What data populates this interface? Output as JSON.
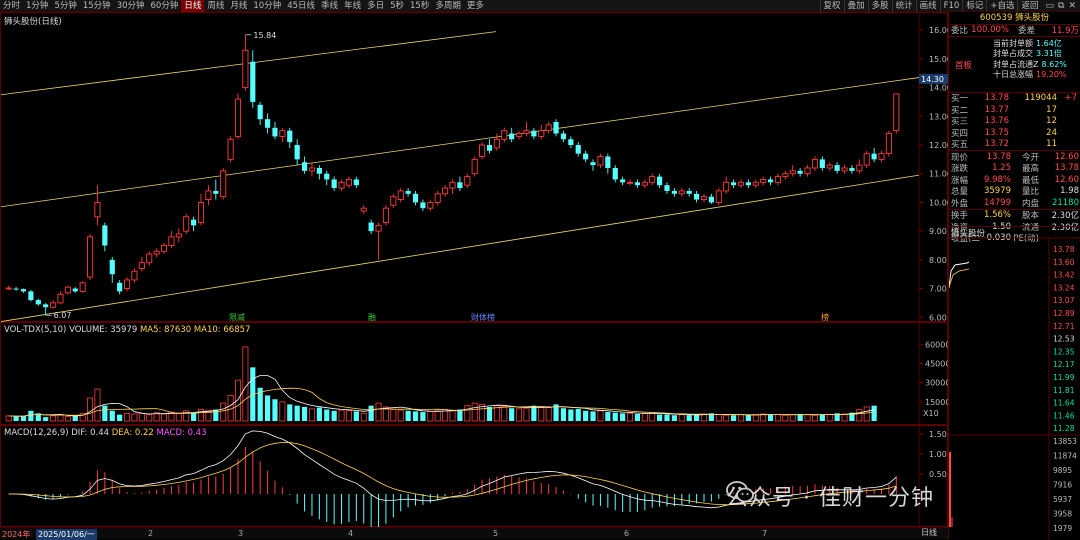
{
  "toolbar": {
    "periods": [
      "分时",
      "1分钟",
      "5分钟",
      "15分钟",
      "30分钟",
      "60分钟",
      "日线",
      "周线",
      "月线",
      "10分钟",
      "45日线",
      "季线",
      "年线",
      "多日",
      "5秒",
      "15秒",
      "多周期",
      "更多"
    ],
    "active_period": "日线",
    "tools": [
      "复权",
      "叠加",
      "多股",
      "统计",
      "画线",
      "F10",
      "标记",
      "+自选",
      "返回"
    ]
  },
  "main_chart": {
    "title": "狮头股份(日线)",
    "price_axis": [
      "16.00",
      "15.00",
      "14.00",
      "13.00",
      "12.00",
      "11.00",
      "10.00",
      "9.00",
      "8.00",
      "7.00",
      "6.00"
    ],
    "current_price_tag": "14.30",
    "high_label": "15.84",
    "low_label": "6.07",
    "markers": [
      {
        "text": "限减",
        "color": "#33cc33"
      },
      {
        "text": "融",
        "color": "#33cc33"
      },
      {
        "text": "财体榜",
        "color": "#6688ff"
      },
      {
        "text": "榜",
        "color": "#ff9933"
      }
    ],
    "colors": {
      "up": "#ff3b3b",
      "down": "#55ffff",
      "channel": "#e8d870"
    }
  },
  "volume_chart": {
    "title": "VOL-TDX(5,10)",
    "volume_label": "VOLUME: 35979",
    "ma5_label": "MA5: 87630",
    "ma10_label": "MA10: 66857",
    "axis": [
      "60000",
      "45000",
      "30000",
      "15000"
    ],
    "unit": "X10"
  },
  "macd_chart": {
    "title": "MACD(12,26,9)",
    "dif": "DIF: 0.44",
    "dea": "DEA: 0.22",
    "macd": "MACD: 0.43",
    "axis": [
      "1.50",
      "1.00",
      "0.50"
    ]
  },
  "x_axis": {
    "labels": [
      "2024年",
      "2025/01/06/一",
      "2",
      "3",
      "4",
      "5",
      "6",
      "7"
    ],
    "period_label": "日线"
  },
  "side_panel": {
    "stock_code": "600539",
    "stock_name": "狮头股份",
    "webi_label": "委比",
    "webi_value": "100.00%",
    "weicha_label": "委差",
    "weicha_value": "11.9万",
    "board_tag": "首板",
    "seal_info": [
      {
        "label": "当前封单额",
        "value": "1.64亿"
      },
      {
        "label": "封单占成交",
        "value": "3.31倍"
      },
      {
        "label": "封单占流通Z",
        "value": "8.62%"
      },
      {
        "label": "十日总涨幅",
        "value": "19.20%"
      }
    ],
    "order_book": [
      {
        "label": "买一",
        "price": "13.78",
        "vol": "119044",
        "delta": "+7"
      },
      {
        "label": "买二",
        "price": "13.77",
        "vol": "17",
        "delta": ""
      },
      {
        "label": "买三",
        "price": "13.76",
        "vol": "12",
        "delta": ""
      },
      {
        "label": "买四",
        "price": "13.75",
        "vol": "24",
        "delta": ""
      },
      {
        "label": "买五",
        "price": "13.72",
        "vol": "11",
        "delta": ""
      }
    ],
    "quote": [
      {
        "l1": "现价",
        "v1": "13.78",
        "l2": "今开",
        "v2": "12.60"
      },
      {
        "l1": "涨跌",
        "v1": "1.25",
        "l2": "最高",
        "v2": "13.78"
      },
      {
        "l1": "涨幅",
        "v1": "9.98%",
        "l2": "最低",
        "v2": "12.60"
      },
      {
        "l1": "总量",
        "v1": "35979",
        "l2": "量比",
        "v2": "1.98"
      },
      {
        "l1": "外盘",
        "v1": "14799",
        "l2": "内盘",
        "v2": "21180"
      }
    ],
    "stats": [
      {
        "l1": "换手",
        "v1": "1.56%",
        "l2": "股本",
        "v2": "2.30亿"
      },
      {
        "l1": "净资",
        "v1": "1.50",
        "l2": "流通",
        "v2": "2.30亿"
      },
      {
        "l1": "收益(二",
        "v1": "-0.030",
        "l2": "PE(动)",
        "v2": "--"
      }
    ],
    "mini_title": "狮头股份",
    "mini_axis": [
      "13.78",
      "13.60",
      "13.42",
      "13.24",
      "13.07",
      "12.89",
      "12.71",
      "12.53",
      "12.35",
      "12.17",
      "11.99",
      "11.81",
      "11.64",
      "11.46",
      "11.28"
    ],
    "mini_vol_axis": [
      "13853",
      "11874",
      "9895",
      "7916",
      "5937",
      "3958",
      "1979"
    ]
  },
  "watermark": {
    "text": "公众号 · 佳财一分钟"
  }
}
